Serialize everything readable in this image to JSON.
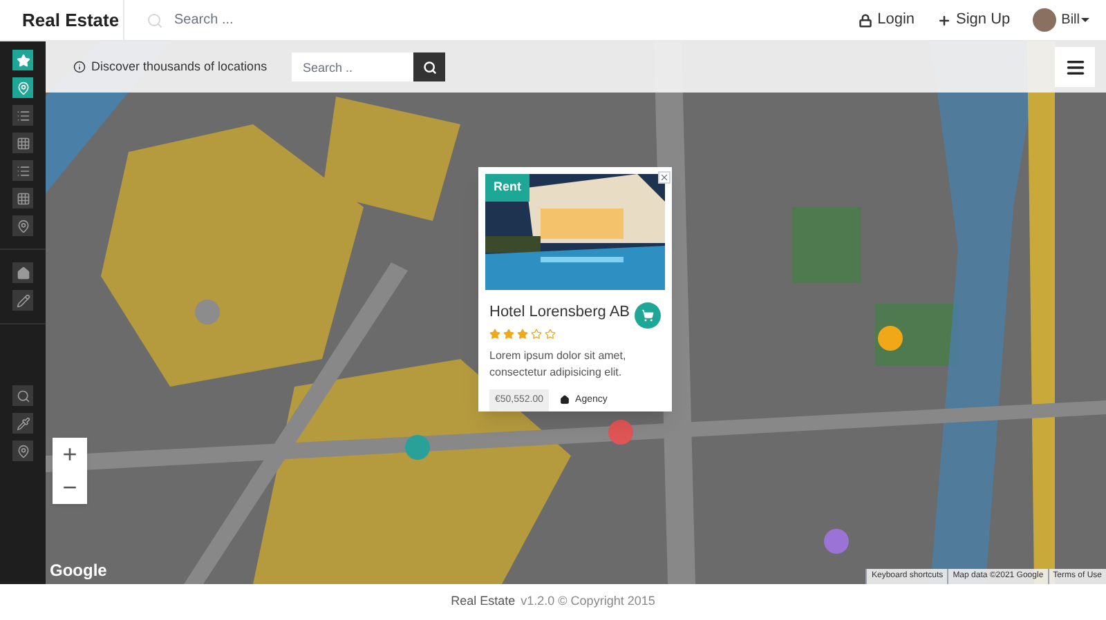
{
  "header": {
    "brand": "Real Estate",
    "search": {
      "placeholder": "Search ..."
    },
    "links": [
      {
        "kind": "lock",
        "label": "Login"
      },
      {
        "kind": "plus",
        "label": "Sign Up"
      }
    ],
    "user": {
      "name": "Bill"
    }
  },
  "sidebar": {
    "items": [
      {
        "kind": "star",
        "selected": true
      },
      {
        "kind": "pin",
        "selected": true
      },
      {
        "kind": "list",
        "selected": false
      },
      {
        "kind": "grid",
        "selected": false
      },
      {
        "kind": "list",
        "selected": false
      },
      {
        "kind": "grid",
        "selected": false
      },
      {
        "kind": "pin",
        "selected": false
      },
      {
        "kind": "home",
        "selected": false
      },
      {
        "kind": "pencil",
        "selected": false
      },
      {
        "kind": "search",
        "selected": false
      },
      {
        "kind": "dropper",
        "selected": false
      },
      {
        "kind": "pin",
        "selected": false
      }
    ]
  },
  "toolbar": {
    "info": "Discover thousands of locations",
    "search": {
      "placeholder": "Search .."
    }
  },
  "map": {
    "kind": "picture",
    "zoom": [
      "+",
      "−"
    ],
    "logo": "Google",
    "attribution": [
      "Keyboard shortcuts",
      "Map data ©2021 Google",
      "Terms of Use"
    ]
  },
  "popup": {
    "badge": "Rent",
    "title": "Hotel Lorensberg AB",
    "stars": 3,
    "description": "Lorem ipsum dolor sit amet, consectetur adipisicing elit.",
    "price": "€50,552.00",
    "agent": "Agency"
  },
  "footer": {
    "brand": "Real Estate",
    "text": "v1.2.0 © Copyright 2015"
  }
}
